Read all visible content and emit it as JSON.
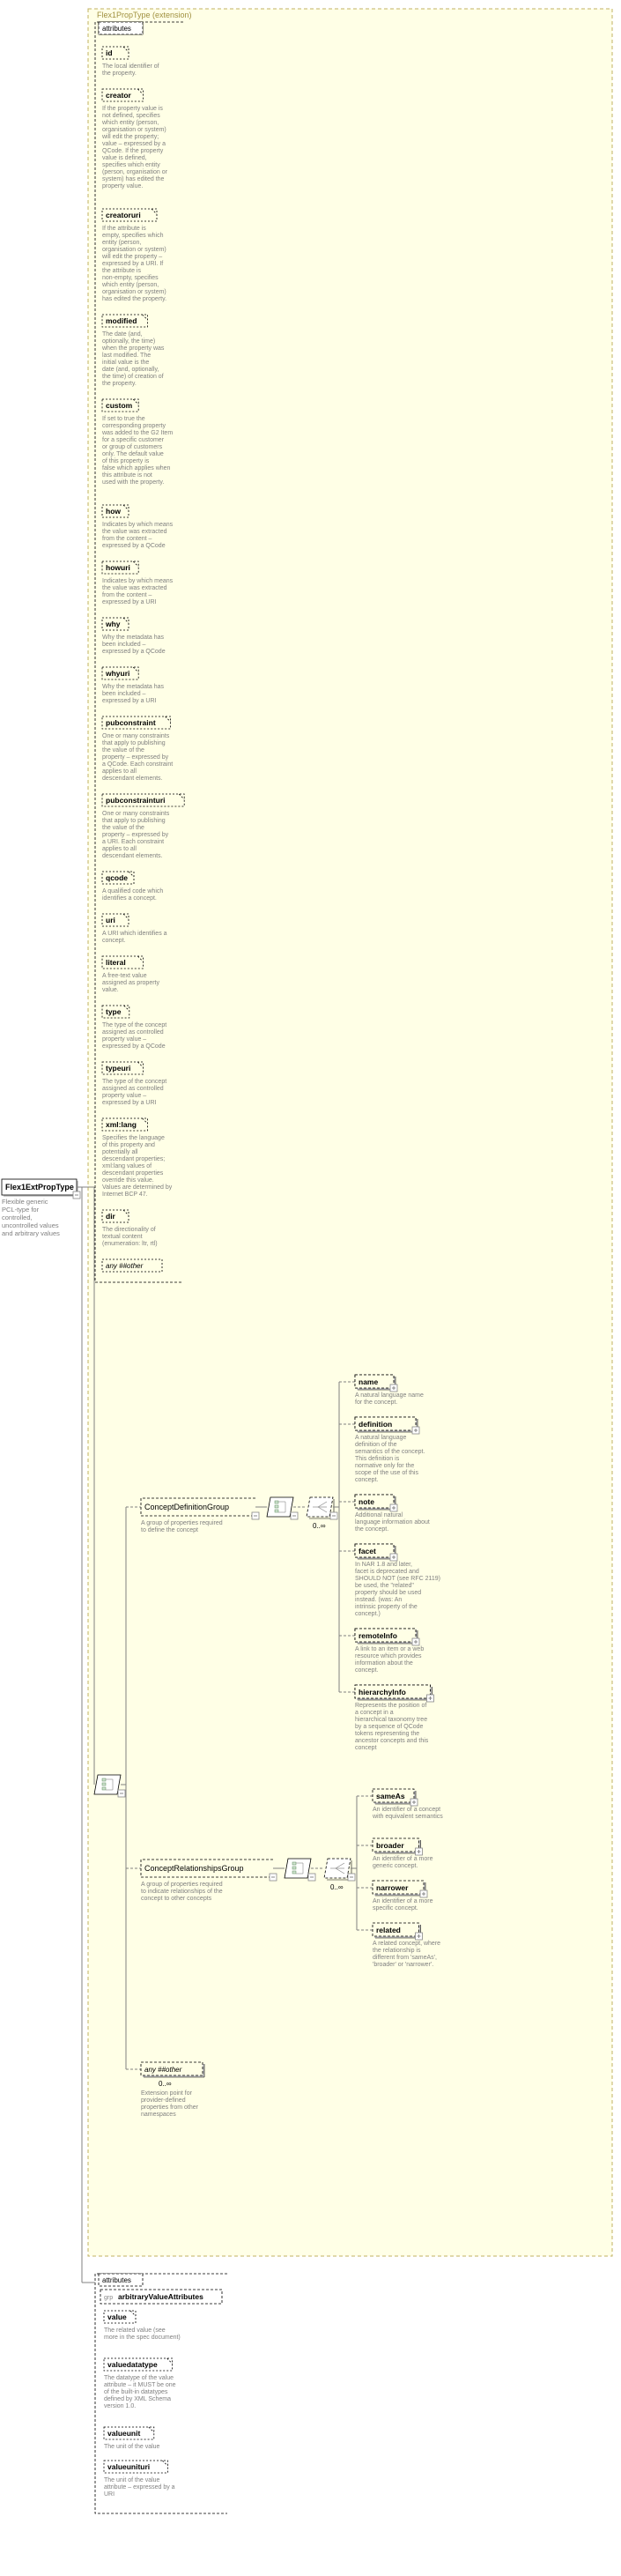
{
  "root": {
    "name": "Flex1ExtPropType",
    "desc": "Flexible generic PCL-type for controlled, uncontrolled values and arbitrary values"
  },
  "extensionLabel": "Flex1PropType (extension)",
  "attrGroupLabel": "attributes",
  "attrs": [
    {
      "name": "id",
      "desc": "The local identifier of the property."
    },
    {
      "name": "creator",
      "desc": "If the property value is not defined, specifies which entity (person, organisation or system) will edit the property; value – expressed by a QCode. If the property value is defined, specifies which entity (person, organisation or system) has edited the property value."
    },
    {
      "name": "creatoruri",
      "desc": "If the attribute is empty, specifies which entity (person, organisation or system) will edit the property – expressed by a URI. If the attribute is non-empty, specifies which entity (person, organisation or system) has edited the property."
    },
    {
      "name": "modified",
      "desc": "The date (and, optionally, the time) when the property was last modified. The initial value is the date (and, optionally, the time) of creation of the property."
    },
    {
      "name": "custom",
      "desc": "If set to true the corresponding property was added to the G2 Item for a specific customer or group of customers only. The default value of this property is false which applies when this attribute is not used with the property."
    },
    {
      "name": "how",
      "desc": "Indicates by which means the value was extracted from the content – expressed by a QCode"
    },
    {
      "name": "howuri",
      "desc": "Indicates by which means the value was extracted from the content – expressed by a URI"
    },
    {
      "name": "why",
      "desc": "Why the metadata has been included – expressed by a QCode"
    },
    {
      "name": "whyuri",
      "desc": "Why the metadata has been included – expressed by a URI"
    },
    {
      "name": "pubconstraint",
      "desc": "One or many constraints that apply to publishing the value of the property – expressed by a QCode. Each constraint applies to all descendant elements."
    },
    {
      "name": "pubconstrainturi",
      "desc": "One or many constraints that apply to publishing the value of the property – expressed by a URI. Each constraint applies to all descendant elements."
    },
    {
      "name": "qcode",
      "desc": "A qualified code which identifies a concept."
    },
    {
      "name": "uri",
      "desc": "A URI which identifies a concept."
    },
    {
      "name": "literal",
      "desc": "A free-text value assigned as property value."
    },
    {
      "name": "type",
      "desc": "The type of the concept assigned as controlled property value – expressed by a QCode"
    },
    {
      "name": "typeuri",
      "desc": "The type of the concept assigned as controlled property value – expressed by a URI"
    },
    {
      "name": "xml:lang",
      "desc": "Specifies the language of this property and potentially all descendant properties; xml:lang values of descendant properties override this value. Values are determined by Internet BCP 47."
    },
    {
      "name": "dir",
      "desc": "The directionality of textual content (enumeration: ltr, rtl)"
    }
  ],
  "anyOther1": "any ##other",
  "cdg": {
    "name": "ConceptDefinitionGroup",
    "desc": "A group of properties required to define the concept",
    "card": "0..∞",
    "children": [
      {
        "name": "name",
        "desc": "A natural language name for the concept."
      },
      {
        "name": "definition",
        "desc": "A natural language definition of the semantics of the concept. This definition is normative only for the scope of the use of this concept."
      },
      {
        "name": "note",
        "desc": "Additional natural language information about the concept."
      },
      {
        "name": "facet",
        "desc": "In NAR 1.8 and later, facet is deprecated and SHOULD NOT (see RFC 2119) be used, the \"related\" property should be used instead. (was: An intrinsic property of the concept.)"
      },
      {
        "name": "remoteInfo",
        "desc": "A link to an item or a web resource which provides information about the concept."
      },
      {
        "name": "hierarchyInfo",
        "desc": "Represents the position of a concept in a hierarchical taxonomy tree by a sequence of QCode tokens representing the ancestor concepts and this concept"
      }
    ]
  },
  "crg": {
    "name": "ConceptRelationshipsGroup",
    "desc": "A group of properties required to indicate relationships of the concept to other concepts",
    "card": "0..∞",
    "children": [
      {
        "name": "sameAs",
        "desc": "An identifier of a concept with equivalent semantics"
      },
      {
        "name": "broader",
        "desc": "An identifier of a more generic concept."
      },
      {
        "name": "narrower",
        "desc": "An identifier of a more specific concept."
      },
      {
        "name": "related",
        "desc": "A related concept, where the relationship is different from 'sameAs', 'broader' or 'narrower'."
      }
    ]
  },
  "anyOther2": {
    "label": "any ##other",
    "card": "0..∞",
    "desc": "Extension point for provider-defined properties from other namespaces"
  },
  "ava": {
    "groupLabel": "attributes",
    "grpPrefix": "grp",
    "grpName": "arbitraryValueAttributes",
    "items": [
      {
        "name": "value",
        "desc": "The related value (see more in the spec document)"
      },
      {
        "name": "valuedatatype",
        "desc": "The datatype of the value attribute – it MUST be one of the built-in datatypes defined by XML Schema version 1.0."
      },
      {
        "name": "valueunit",
        "desc": "The unit of the value"
      },
      {
        "name": "valueunituri",
        "desc": "The unit of the value attribute – expressed by a URI"
      }
    ]
  }
}
